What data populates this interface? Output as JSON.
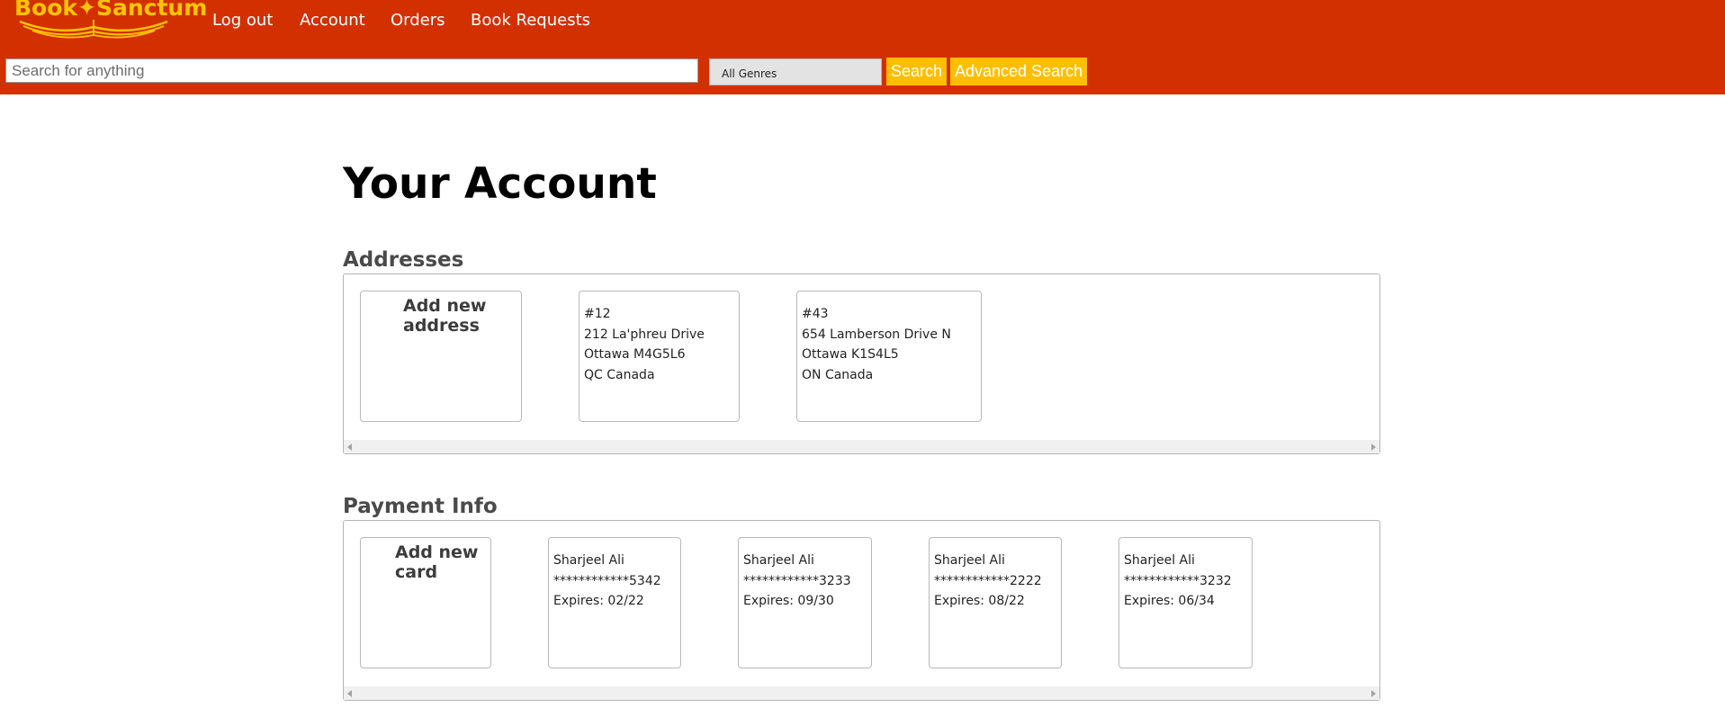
{
  "header": {
    "logo_text": "Book✦Sanctum",
    "nav": [
      "Log out",
      "Account",
      "Orders",
      "Book Requests"
    ],
    "search_placeholder": "Search for anything",
    "genre_selected": "All Genres",
    "search_label": "Search",
    "advanced_search_label": "Advanced Search"
  },
  "page_title": "Your Account",
  "addresses": {
    "title": "Addresses",
    "add_label": "Add new\naddress",
    "items": [
      {
        "unit": "#12",
        "street": "212 La'phreu Drive",
        "city_postal": "Ottawa M4G5L6",
        "region_country": "QC Canada"
      },
      {
        "unit": "#43",
        "street": "654 Lamberson Drive N",
        "city_postal": "Ottawa K1S4L5",
        "region_country": "ON Canada"
      }
    ]
  },
  "payment": {
    "title": "Payment Info",
    "add_label": "Add new\ncard",
    "cards": [
      {
        "name": "Sharjeel Ali",
        "number": "************5342",
        "expires": "Expires: 02/22"
      },
      {
        "name": "Sharjeel Ali",
        "number": "************3233",
        "expires": "Expires: 09/30"
      },
      {
        "name": "Sharjeel Ali",
        "number": "************2222",
        "expires": "Expires: 08/22"
      },
      {
        "name": "Sharjeel Ali",
        "number": "************3232",
        "expires": "Expires: 06/34"
      }
    ]
  },
  "colors": {
    "header_bg": "#d33000",
    "accent": "#ffbf00",
    "logo": "#ffc400"
  }
}
